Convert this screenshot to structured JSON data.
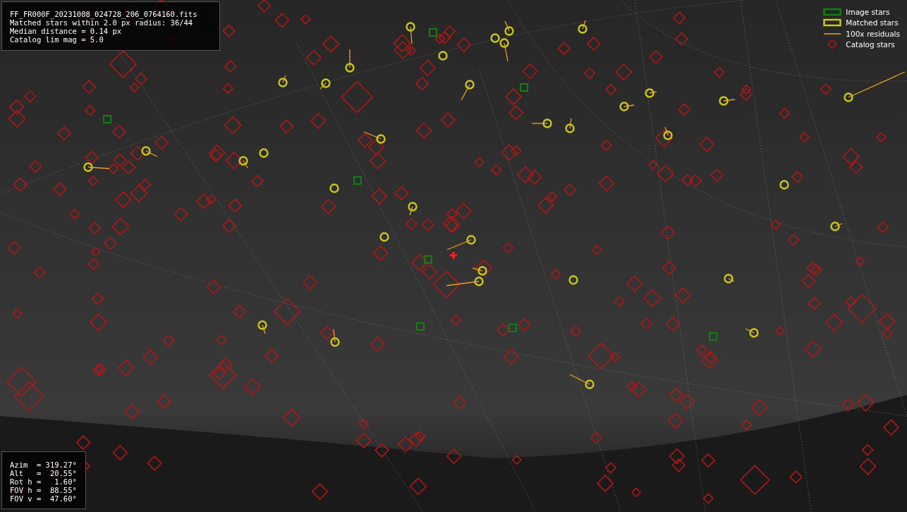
{
  "info_box": {
    "lines": [
      "FF_FR000F_20231008_024728_206_0764160.fits",
      "Matched stars within 2.0 px radius: 36/44",
      "Median distance = 0.14 px",
      "Catalog lim mag = 5.0"
    ]
  },
  "legend": {
    "items": [
      {
        "kind": "image",
        "label": "Image stars"
      },
      {
        "kind": "matched",
        "label": "Matched stars"
      },
      {
        "kind": "residual",
        "label": "100x residuals"
      },
      {
        "kind": "catalog",
        "label": "Catalog stars"
      }
    ]
  },
  "pointing_box": {
    "lines": [
      "Azim  = 319.27°",
      "Alt   =  20.55°",
      "Rot h =   1.60°",
      "FOV h =  88.55°",
      "FOV v =  47.60°"
    ]
  }
}
